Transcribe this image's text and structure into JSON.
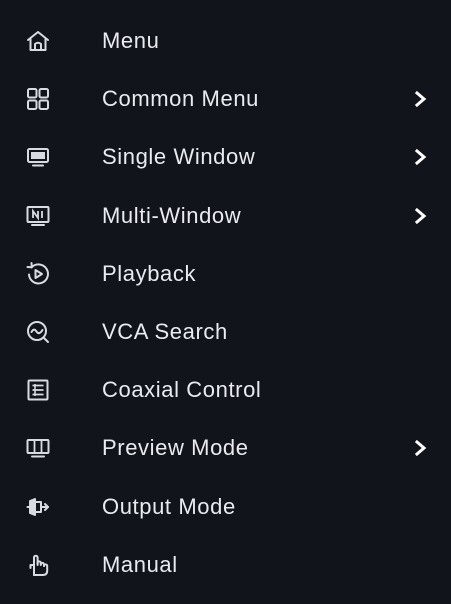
{
  "menu": {
    "items": [
      {
        "label": "Menu",
        "icon": "home-icon",
        "has_submenu": false
      },
      {
        "label": "Common Menu",
        "icon": "grid-icon",
        "has_submenu": true
      },
      {
        "label": "Single Window",
        "icon": "monitor-icon",
        "has_submenu": true
      },
      {
        "label": "Multi-Window",
        "icon": "multi-window-icon",
        "has_submenu": true
      },
      {
        "label": "Playback",
        "icon": "playback-icon",
        "has_submenu": false
      },
      {
        "label": "VCA Search",
        "icon": "vca-search-icon",
        "has_submenu": false
      },
      {
        "label": "Coaxial Control",
        "icon": "coaxial-control-icon",
        "has_submenu": false
      },
      {
        "label": "Preview Mode",
        "icon": "preview-mode-icon",
        "has_submenu": true
      },
      {
        "label": "Output Mode",
        "icon": "output-mode-icon",
        "has_submenu": false
      },
      {
        "label": "Manual",
        "icon": "manual-icon",
        "has_submenu": false
      }
    ],
    "colors": {
      "background": "#12141c",
      "text": "#e9ebf0",
      "icon": "#d8dbe2"
    }
  }
}
